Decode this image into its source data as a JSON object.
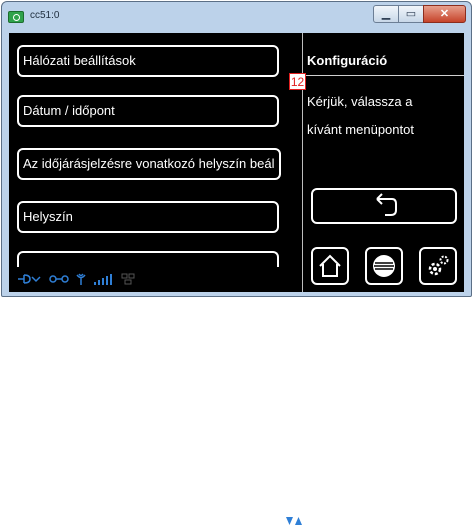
{
  "window": {
    "title": "cc51:0",
    "min": "▁",
    "max": "▭",
    "close": "✕"
  },
  "menu": {
    "items": [
      {
        "label": "Hálózati beállítások"
      },
      {
        "label": "Dátum / időpont"
      },
      {
        "label": "Az időjárásjelzésre vonatkozó helyszín beál"
      },
      {
        "label": "Helyszín"
      },
      {
        "label": ""
      }
    ]
  },
  "panel": {
    "title": "Konfiguráció",
    "badge": "12",
    "line1": "Kérjük, válassza a",
    "line2": "kívánt menüpontot"
  },
  "icons": {
    "back": "back-arrow-icon",
    "home": "home-icon",
    "brand": "brand-logo-icon",
    "settings": "gear-icon"
  },
  "colors": {
    "accent": "#2f7fd6",
    "screen_bg": "#000000",
    "text": "#ffffff"
  }
}
